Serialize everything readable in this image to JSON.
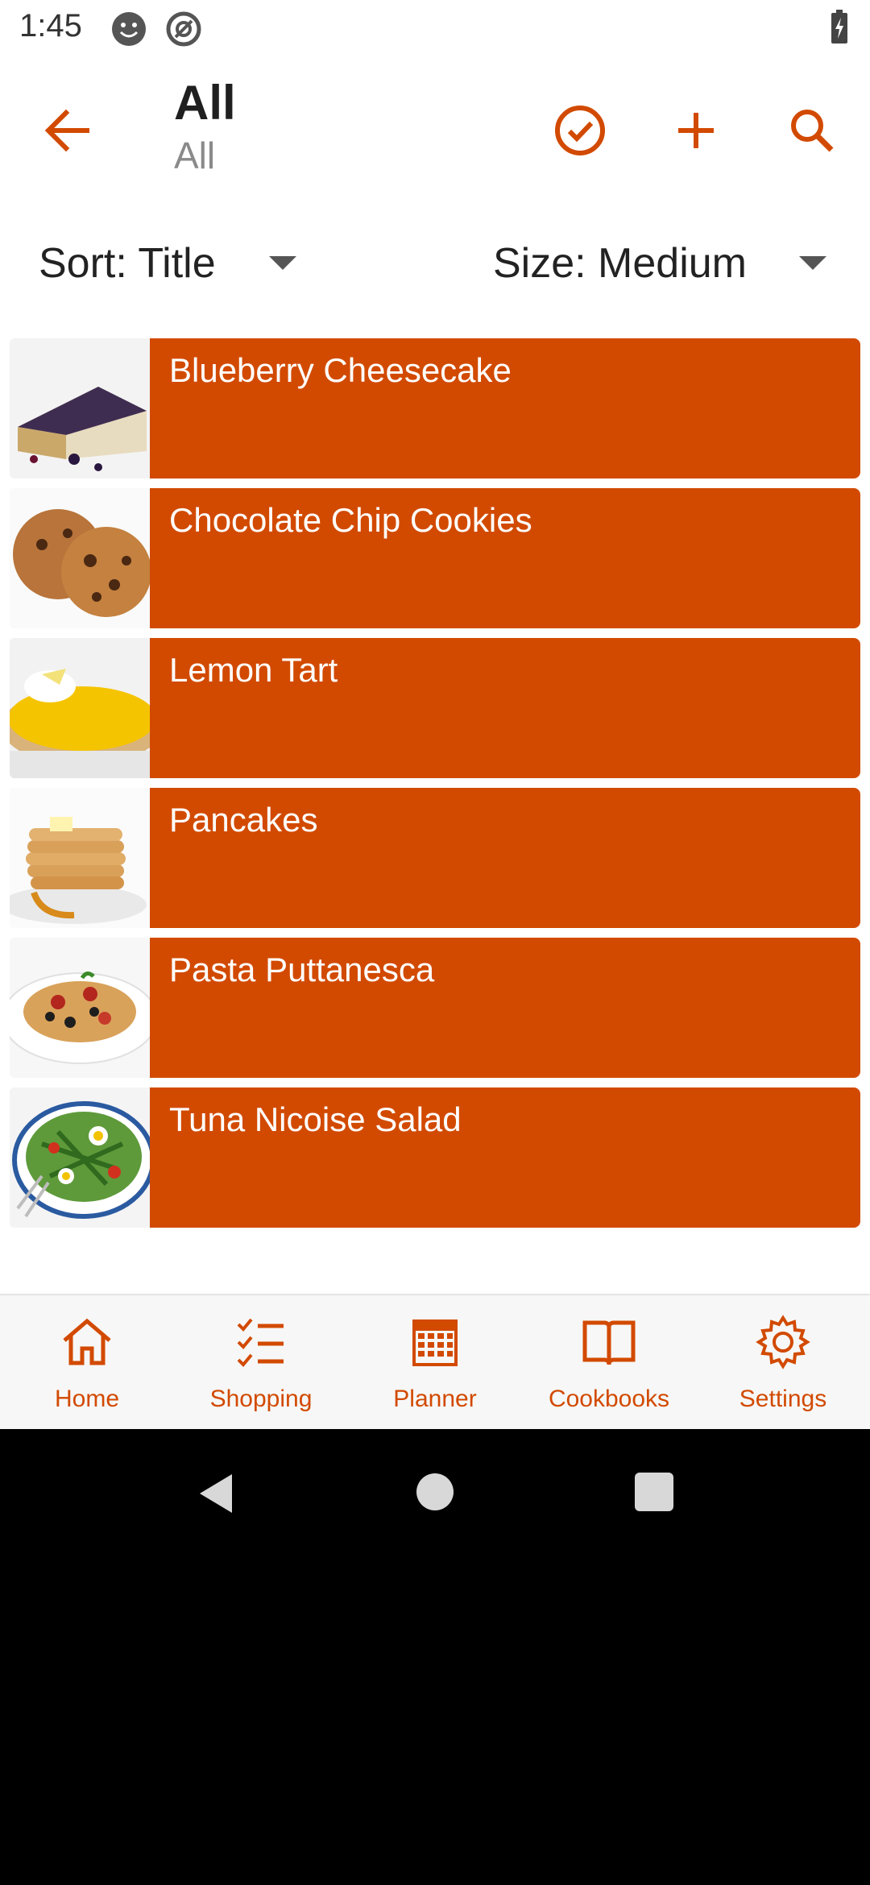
{
  "status_bar": {
    "time": "1:45",
    "icons": [
      "face-icon",
      "at-circle-icon",
      "battery-charging-icon"
    ]
  },
  "app_bar": {
    "title": "All",
    "subtitle": "All",
    "actions": [
      "back-arrow-icon",
      "check-circle-icon",
      "add-icon",
      "search-icon"
    ]
  },
  "sort": {
    "label": "Sort: Title"
  },
  "size": {
    "label": "Size: Medium"
  },
  "recipes": [
    {
      "title": "Blueberry Cheesecake",
      "image": "cheesecake-image"
    },
    {
      "title": "Chocolate Chip Cookies",
      "image": "cookies-image"
    },
    {
      "title": "Lemon Tart",
      "image": "lemon-tart-image"
    },
    {
      "title": "Pancakes",
      "image": "pancakes-image"
    },
    {
      "title": "Pasta Puttanesca",
      "image": "pasta-image"
    },
    {
      "title": "Tuna Nicoise Salad",
      "image": "salad-image"
    }
  ],
  "nav": [
    {
      "label": "Home",
      "icon": "home-icon"
    },
    {
      "label": "Shopping",
      "icon": "checklist-icon"
    },
    {
      "label": "Planner",
      "icon": "calendar-icon"
    },
    {
      "label": "Cookbooks",
      "icon": "book-icon"
    },
    {
      "label": "Settings",
      "icon": "gear-icon"
    }
  ],
  "colors": {
    "accent": "#d24a00",
    "card": "#d24a00",
    "nav_bg": "#f7f7f7"
  }
}
